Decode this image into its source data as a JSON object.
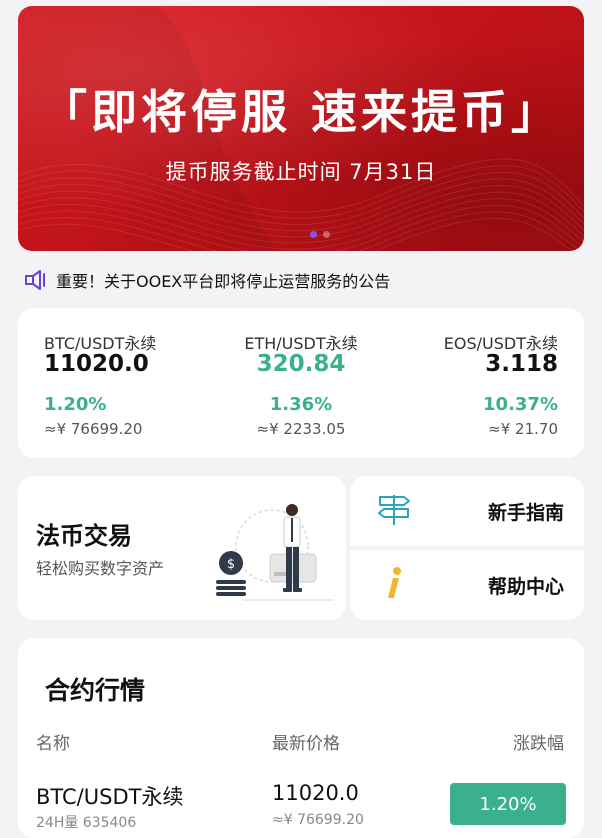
{
  "banner": {
    "title": "「即将停服  速来提币」",
    "subtitle": "提币服务截止时间 7月31日",
    "slides": 2,
    "active_slide": 1
  },
  "notice": {
    "icon": "megaphone-icon",
    "text": "重要！关于OOEX平台即将停止运营服务的公告"
  },
  "tickers": [
    {
      "pair": "BTC/USDT永续",
      "price": "11020.0",
      "change": "1.20%",
      "fiat": "≈¥ 76699.20"
    },
    {
      "pair": "ETH/USDT永续",
      "price": "320.84",
      "change": "1.36%",
      "fiat": "≈¥ 2233.05"
    },
    {
      "pair": "EOS/USDT永续",
      "price": "3.118",
      "change": "10.37%",
      "fiat": "≈¥ 21.70"
    }
  ],
  "fiat_trade": {
    "title": "法币交易",
    "subtitle": "轻松购买数字资产"
  },
  "guide": {
    "label": "新手指南",
    "icon": "signpost-icon"
  },
  "help": {
    "label": "帮助中心",
    "icon": "info-icon"
  },
  "market": {
    "title": "合约行情",
    "headers": {
      "name": "名称",
      "price": "最新价格",
      "change": "涨跌幅"
    },
    "rows": [
      {
        "name": "BTC/USDT永续",
        "volume": "24H量 635406",
        "price": "11020.0",
        "fiat": "≈¥ 76699.20",
        "change": "1.20%"
      }
    ]
  },
  "colors": {
    "banner_red": "#d8191f",
    "up_green": "#3bb08f",
    "accent_purple": "#7a5cf0"
  }
}
